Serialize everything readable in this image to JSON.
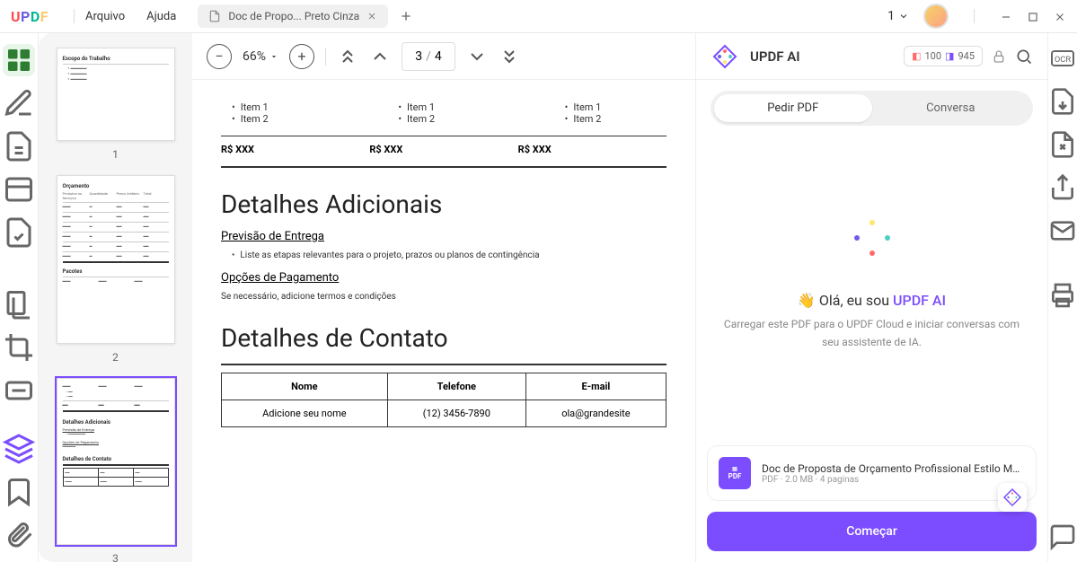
{
  "app": {
    "logo": "UPDF",
    "menus": [
      "Arquivo",
      "Ajuda"
    ],
    "tab": {
      "title": "Doc de Propo... Preto Cinza"
    },
    "page_dd": "1"
  },
  "toolbar": {
    "zoom": "66%",
    "current_page": "3",
    "total_pages": "4"
  },
  "thumbs": [
    {
      "num": "1"
    },
    {
      "num": "2"
    },
    {
      "num": "3"
    }
  ],
  "thumb_content": {
    "t1_h1": "Escopo do Trabalho",
    "t2_h1": "Orçamento",
    "t2_sub1": "Produtos ou Serviços",
    "t2_c2": "Quantidade",
    "t2_c3": "Preço Unitário",
    "t2_c4": "Total",
    "t2_pac": "Pacotes",
    "t3_h1": "Detalhes Adicionais",
    "t3_s1": "Previsão de Entrega",
    "t3_s2": "Opções de Pagamento",
    "t3_h2": "Detalhes de Contato"
  },
  "doc": {
    "items": [
      {
        "i1": "Item 1",
        "i2": "Item 2"
      },
      {
        "i1": "Item 1",
        "i2": "Item 2"
      },
      {
        "i1": "Item 1",
        "i2": "Item 2"
      }
    ],
    "prices": [
      "R$ XXX",
      "R$ XXX",
      "R$ XXX"
    ],
    "h_additional": "Detalhes Adicionais",
    "h_forecast": "Previsão de Entrega",
    "forecast_bullet": "Liste as etapas relevantes para o projeto, prazos ou planos de contingência",
    "h_payment": "Opções de Pagamento",
    "payment_text": "Se necessário, adicione termos e condições",
    "h_contact": "Detalhes de Contato",
    "contact": {
      "th": [
        "Nome",
        "Telefone",
        "E-mail"
      ],
      "td": [
        "Adicione seu nome",
        "(12) 3456-7890",
        "ola@grandesite"
      ]
    }
  },
  "ai": {
    "title": "UPDF AI",
    "credits": {
      "a": "100",
      "b": "945"
    },
    "tabs": [
      "Pedir PDF",
      "Conversa"
    ],
    "greeting_pre": "Olá, eu sou",
    "greeting_brand": "UPDF AI",
    "subtext": "Carregar este PDF para o UPDF Cloud e iniciar conversas com seu assistente de IA.",
    "file": {
      "name": "Doc de Proposta de Orçamento Profissional Estilo Monocr...",
      "meta": "PDF · 2.0 MB · 4 paginas",
      "badge": "PDF"
    },
    "start_label": "Começar"
  }
}
